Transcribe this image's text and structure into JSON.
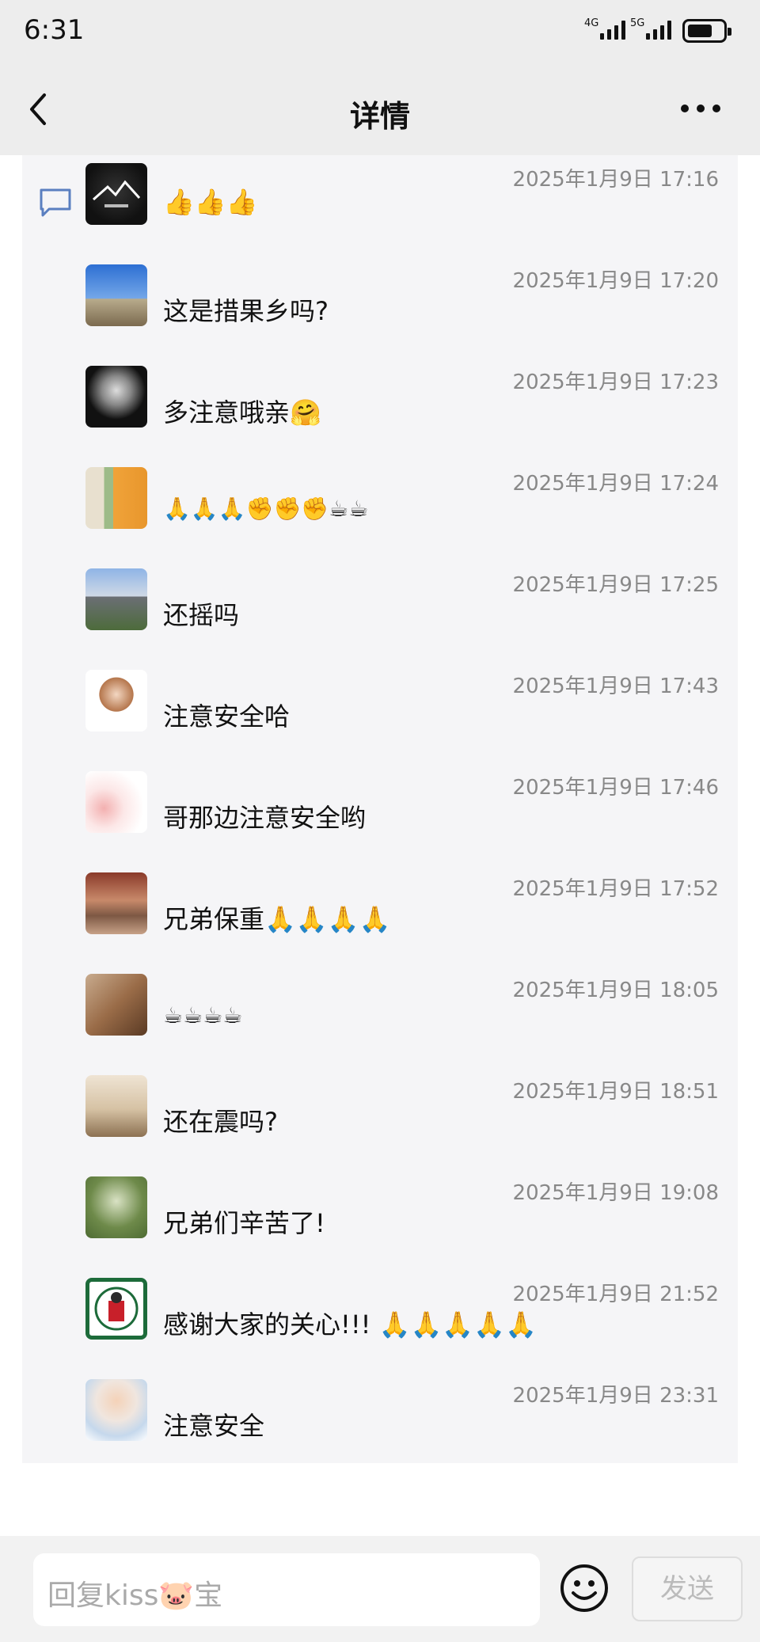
{
  "status_bar": {
    "time": "6:31",
    "net1": "4G",
    "net2": "5G"
  },
  "nav": {
    "title": "详情"
  },
  "comments": [
    {
      "time": "2025年1月9日 17:16",
      "text": "👍👍👍"
    },
    {
      "time": "2025年1月9日 17:20",
      "text": "这是措果乡吗?"
    },
    {
      "time": "2025年1月9日 17:23",
      "text": "多注意哦亲🤗"
    },
    {
      "time": "2025年1月9日 17:24",
      "text": "🙏🙏🙏✊✊✊☕☕"
    },
    {
      "time": "2025年1月9日 17:25",
      "text": "还摇吗"
    },
    {
      "time": "2025年1月9日 17:43",
      "text": "注意安全哈"
    },
    {
      "time": "2025年1月9日 17:46",
      "text": "哥那边注意安全哟"
    },
    {
      "time": "2025年1月9日 17:52",
      "text": "兄弟保重🙏🙏🙏🙏"
    },
    {
      "time": "2025年1月9日 18:05",
      "text": "☕☕☕☕"
    },
    {
      "time": "2025年1月9日 18:51",
      "text": "还在震吗?"
    },
    {
      "time": "2025年1月9日 19:08",
      "text": "兄弟们辛苦了!"
    },
    {
      "time": "2025年1月9日 21:52",
      "text": "感谢大家的关心!!! 🙏🙏🙏🙏🙏"
    },
    {
      "time": "2025年1月9日 23:31",
      "text": "注意安全"
    }
  ],
  "input": {
    "placeholder": "回复kiss🐷宝",
    "send_label": "发送"
  },
  "colors": {
    "bg": "#ededed",
    "list_bg": "#f5f5f7",
    "timestamp": "#888888",
    "accent_icon": "#5a7fc0"
  }
}
